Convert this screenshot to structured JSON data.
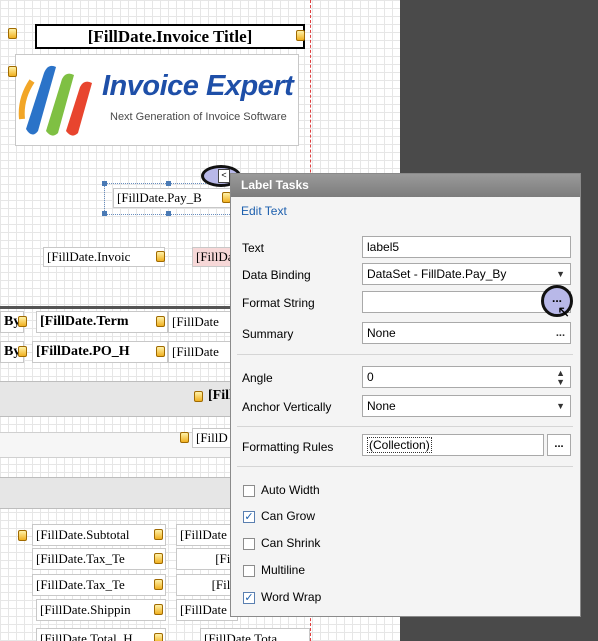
{
  "designer": {
    "title_field": "[FillDate.Invoice  Title]",
    "logo_name": "Invoice Expert",
    "logo_tagline": "Next Generation of Invoice Software",
    "selected_field": "[FillDate.Pay_B",
    "invoice_field": "[FillDate.Invoic",
    "invoice_field2": "[FillDa",
    "terms_field": "[FillDate.Term",
    "terms_right": "[FillDate",
    "po_field": "[FillDate.PO_H",
    "po_right": "[FillDate",
    "band1_field": "[Fill",
    "band2_field": "[FillD",
    "by1": "By",
    "by2": "By",
    "subtotal": "[FillDate.Subtotal",
    "subtotal_right": "[FillDate",
    "tax1": "[FillDate.Tax_Te",
    "tax1_right": "[Fil",
    "tax2": "[FillDate.Tax_Te",
    "tax2_right": "[Fill",
    "shipping": "[FillDate.Shippin",
    "shipping_right": "[FillDate",
    "total": "[FillDate.Total_H",
    "total_right": "[FillDate.Tota"
  },
  "panel": {
    "title": "Label Tasks",
    "smart_tag": "<",
    "edit_text": "Edit Text",
    "rows": {
      "text_label": "Text",
      "text_value": "label5",
      "binding_label": "Data Binding",
      "binding_value": "DataSet - FillDate.Pay_By",
      "format_label": "Format String",
      "format_value": "",
      "summary_label": "Summary",
      "summary_value": "None",
      "angle_label": "Angle",
      "angle_value": "0",
      "anchor_label": "Anchor Vertically",
      "anchor_value": "None",
      "rules_label": "Formatting Rules",
      "rules_value": "(Collection)"
    },
    "ellipsis": "...",
    "checkboxes": [
      {
        "label": "Auto Width",
        "checked": false
      },
      {
        "label": "Can Grow",
        "checked": true
      },
      {
        "label": "Can Shrink",
        "checked": false
      },
      {
        "label": "Multiline",
        "checked": false
      },
      {
        "label": "Word Wrap",
        "checked": true
      }
    ]
  },
  "colors": {
    "accent": "#1c5fae",
    "dark_pane": "#4a4a4a",
    "logo_blue": "#1e4fa8"
  }
}
